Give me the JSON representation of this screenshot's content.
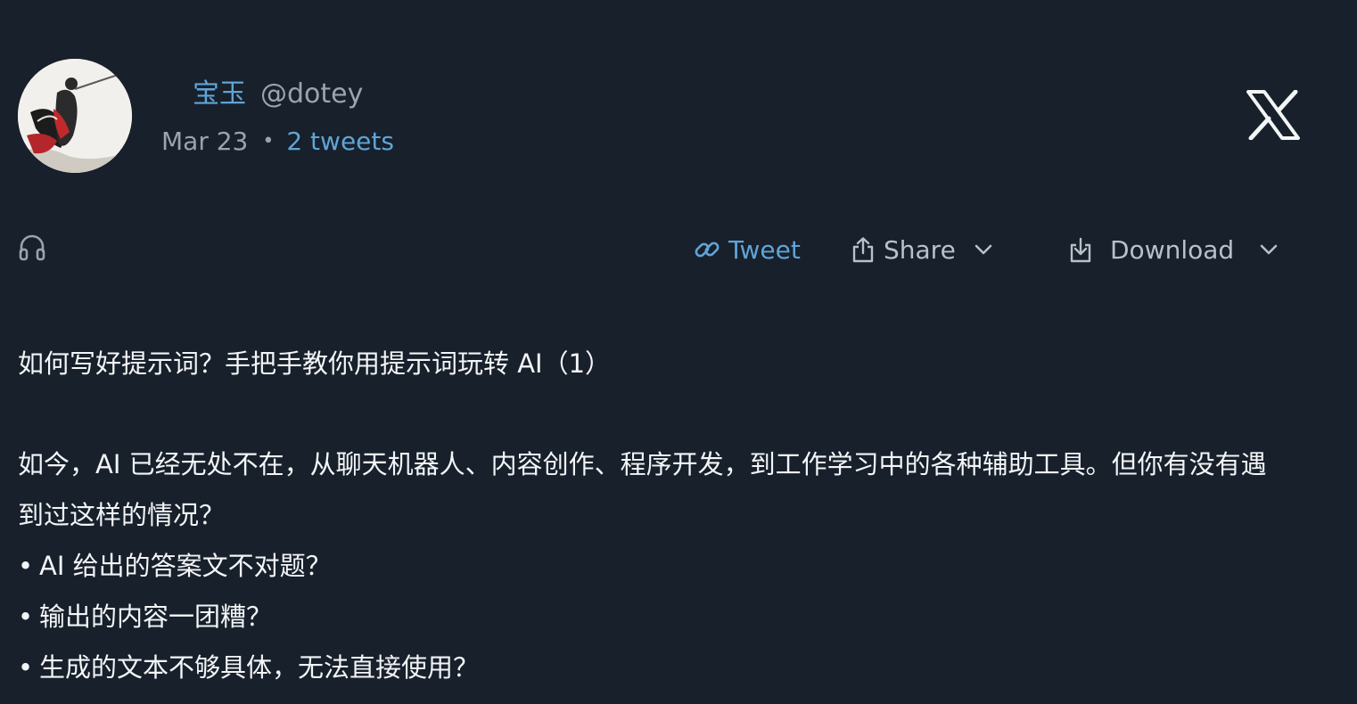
{
  "author": {
    "display_name": "宝玉",
    "handle": "@dotey",
    "avatar_icon": "avatar-ink-painting"
  },
  "meta": {
    "date": "Mar 23",
    "separator": "•",
    "tweet_count": "2 tweets"
  },
  "header": {
    "logo_icon": "x-logo"
  },
  "actions": {
    "listen_icon": "headphones-icon",
    "tweet_label": "Tweet",
    "share_label": "Share",
    "download_label": "Download"
  },
  "post": {
    "title": "如何写好提示词？手把手教你用提示词玩转 AI（1）",
    "intro": "如今，AI 已经无处不在，从聊天机器人、内容创作、程序开发，到工作学习中的各种辅助工具。但你有没有遇到过这样的情况？",
    "bullets": [
      "AI 给出的答案文不对题？",
      "输出的内容一团糟？",
      "生成的文本不够具体，无法直接使用？"
    ]
  },
  "colors": {
    "background": "#17202b",
    "accent": "#60a4d6",
    "muted": "#9aa4ae",
    "text": "#f3f5f7"
  }
}
